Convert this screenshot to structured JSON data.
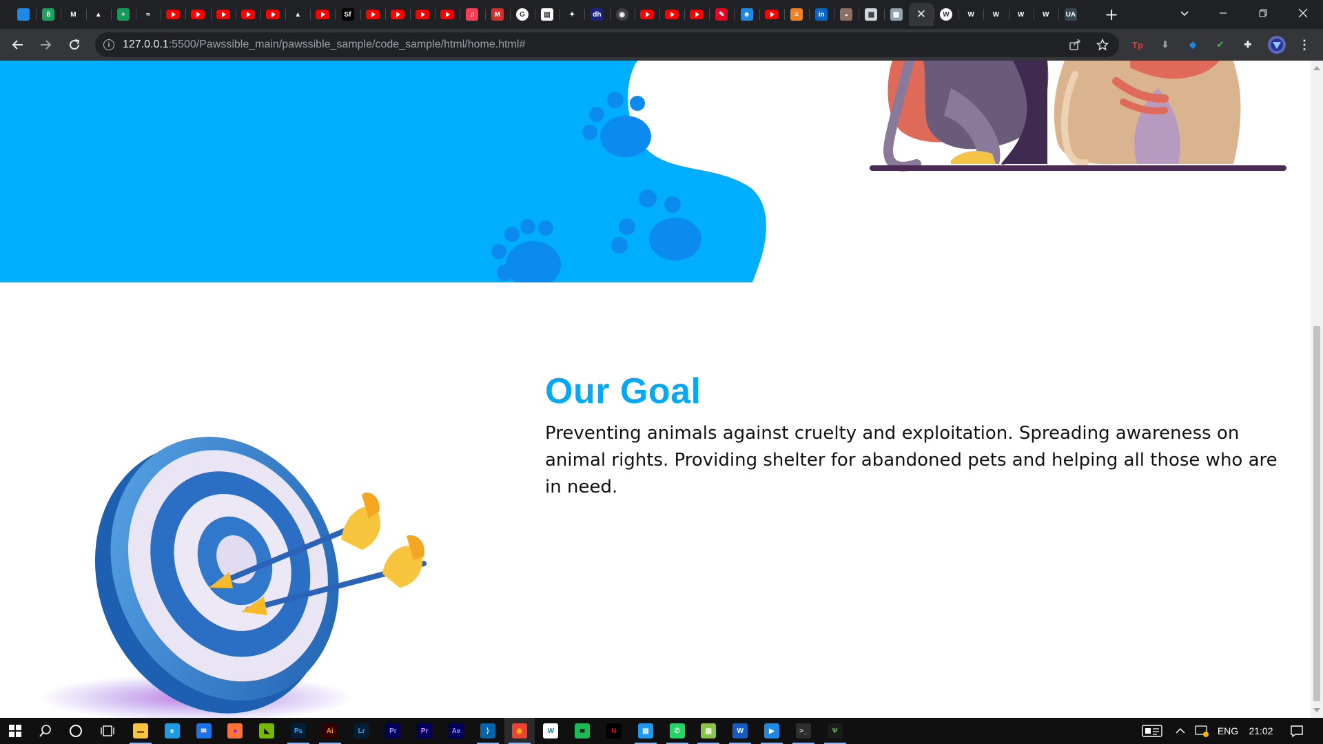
{
  "browser": {
    "tabs": [
      {
        "icon": "sapphire-gem-icon",
        "glyph": "",
        "color": "#1e88e5"
      },
      {
        "icon": "green-tag-icon",
        "glyph": "ß",
        "color": "#1aa260"
      },
      {
        "icon": "gmail-icon",
        "glyph": "M",
        "color": "#202124"
      },
      {
        "icon": "google-drive-icon",
        "glyph": "▲",
        "color": "#202124"
      },
      {
        "icon": "google-sheets-plus-icon",
        "glyph": "+",
        "color": "#0f9d58"
      },
      {
        "icon": "chart-app-icon",
        "glyph": "≈",
        "color": "#202124"
      },
      {
        "icon": "youtube-icon",
        "glyph": "",
        "color": "#ff0000"
      },
      {
        "icon": "youtube-icon",
        "glyph": "",
        "color": "#ff0000"
      },
      {
        "icon": "youtube-icon",
        "glyph": "",
        "color": "#ff0000"
      },
      {
        "icon": "youtube-icon",
        "glyph": "",
        "color": "#ff0000"
      },
      {
        "icon": "youtube-icon",
        "glyph": "",
        "color": "#ff0000"
      },
      {
        "icon": "google-drive-icon",
        "glyph": "▲",
        "color": "#202124"
      },
      {
        "icon": "youtube-icon",
        "glyph": "",
        "color": "#ff0000"
      },
      {
        "icon": "sf-icon",
        "glyph": "Sf",
        "color": "#000000"
      },
      {
        "icon": "youtube-icon",
        "glyph": "",
        "color": "#ff0000"
      },
      {
        "icon": "youtube-icon",
        "glyph": "",
        "color": "#ff0000"
      },
      {
        "icon": "youtube-icon",
        "glyph": "",
        "color": "#ff0000"
      },
      {
        "icon": "youtube-icon",
        "glyph": "",
        "color": "#ff0000"
      },
      {
        "icon": "music-note-icon",
        "glyph": "♫",
        "color": "#fa3c55"
      },
      {
        "icon": "red-m-icon",
        "glyph": "M",
        "color": "#d32f2f"
      },
      {
        "icon": "google-icon",
        "glyph": "G",
        "color": "#ffffff"
      },
      {
        "icon": "document-icon",
        "glyph": "▤",
        "color": "#ffffff"
      },
      {
        "icon": "feather-icon",
        "glyph": "✦",
        "color": "#202124"
      },
      {
        "icon": "dh-icon",
        "glyph": "dh",
        "color": "#1a237e"
      },
      {
        "icon": "globe-icon",
        "glyph": "◉",
        "color": "#424242"
      },
      {
        "icon": "youtube-icon",
        "glyph": "",
        "color": "#ff0000"
      },
      {
        "icon": "youtube-icon",
        "glyph": "",
        "color": "#ff0000"
      },
      {
        "icon": "youtube-icon",
        "glyph": "",
        "color": "#ff0000"
      },
      {
        "icon": "pinterest-like-icon",
        "glyph": "✎",
        "color": "#e60023"
      },
      {
        "icon": "reddit-like-icon",
        "glyph": "☻",
        "color": "#1e88e5"
      },
      {
        "icon": "youtube-icon",
        "glyph": "",
        "color": "#ff0000"
      },
      {
        "icon": "stack-overflow-icon",
        "glyph": "≡",
        "color": "#f48024"
      },
      {
        "icon": "linkedin-icon",
        "glyph": "in",
        "color": "#0a66c2"
      },
      {
        "icon": "food-icon",
        "glyph": "◒",
        "color": "#8d6e63"
      },
      {
        "icon": "image-thumb-icon",
        "glyph": "▦",
        "color": "#cfd8dc"
      },
      {
        "icon": "image-thumb-icon",
        "glyph": "▦",
        "color": "#90a4ae"
      },
      {
        "icon": "close-icon",
        "glyph": "✕",
        "color": "",
        "active": true
      },
      {
        "icon": "wordpress-icon",
        "glyph": "W",
        "color": "#ffffff"
      },
      {
        "icon": "w-green-icon",
        "glyph": "W",
        "color": "#202124"
      },
      {
        "icon": "w-green-icon",
        "glyph": "W",
        "color": "#202124"
      },
      {
        "icon": "w-green-icon",
        "glyph": "W",
        "color": "#202124"
      },
      {
        "icon": "w-green-icon",
        "glyph": "W",
        "color": "#202124"
      },
      {
        "icon": "ua-icon",
        "glyph": "UA",
        "color": "#37474f"
      }
    ],
    "new_tab_label": "+",
    "address": {
      "host": "127.0.0.1",
      "path": ":5500/Pawssible_main/pawssible_sample/code_sample/html/home.html#"
    },
    "toolbar_extensions": [
      {
        "icon": "tp-extension-icon",
        "glyph": "Tp",
        "color": "#e53935"
      },
      {
        "icon": "download-extension-icon",
        "glyph": "⬇",
        "color": "#9e9e9e"
      },
      {
        "icon": "gem-extension-icon",
        "glyph": "◆",
        "color": "#1e88e5"
      },
      {
        "icon": "shield-extension-icon",
        "glyph": "✔",
        "color": "#43a047"
      },
      {
        "icon": "puzzle-extensions-icon",
        "glyph": "✚",
        "color": "#e8eaed"
      }
    ]
  },
  "page": {
    "goal_title": "Our Goal",
    "goal_text": "Preventing animals against cruelty and exploitation. Spreading awareness on animal rights. Providing shelter for abandoned pets and helping all those who are in need.",
    "colors": {
      "accent": "#05a8f5",
      "hero_blue": "#00aeff",
      "paw_blue": "#0b8af0",
      "text": "#111111"
    }
  },
  "taskbar": {
    "apps": [
      {
        "icon": "file-explorer-icon",
        "glyph": "▬",
        "bg": "#f6c642",
        "fg": "#8a5a00",
        "running": true
      },
      {
        "icon": "edge-icon",
        "glyph": "e",
        "bg": "#1f9be0",
        "fg": "#fff"
      },
      {
        "icon": "mail-icon",
        "glyph": "✉",
        "bg": "#1a73e8",
        "fg": "#fff"
      },
      {
        "icon": "firefox-icon",
        "glyph": "●",
        "bg": "#ff7139",
        "fg": "#7b2cbf"
      },
      {
        "icon": "nvidia-icon",
        "glyph": "◣",
        "bg": "#76b900",
        "fg": "#111"
      },
      {
        "icon": "photoshop-icon",
        "glyph": "Ps",
        "bg": "#001e36",
        "fg": "#31a8ff",
        "running": true
      },
      {
        "icon": "illustrator-icon",
        "glyph": "Ai",
        "bg": "#330000",
        "fg": "#ff9a00",
        "running": true
      },
      {
        "icon": "lightroom-icon",
        "glyph": "Lr",
        "bg": "#001e36",
        "fg": "#31a8ff"
      },
      {
        "icon": "premiere-icon",
        "glyph": "Pr",
        "bg": "#00005b",
        "fg": "#9999ff"
      },
      {
        "icon": "premiere-rush-icon",
        "glyph": "Pr",
        "bg": "#00005b",
        "fg": "#d291ff"
      },
      {
        "icon": "after-effects-icon",
        "glyph": "Ae",
        "bg": "#00005b",
        "fg": "#9999ff"
      },
      {
        "icon": "vscode-icon",
        "glyph": "⟩",
        "bg": "#0065a9",
        "fg": "#fff",
        "running": true
      },
      {
        "icon": "chrome-icon",
        "glyph": "◉",
        "bg": "#ea4335",
        "fg": "#fbbc05",
        "running": true,
        "active": true
      },
      {
        "icon": "wordpress-app-icon",
        "glyph": "W",
        "bg": "#ffffff",
        "fg": "#21759b"
      },
      {
        "icon": "spotify-icon",
        "glyph": "≋",
        "bg": "#1db954",
        "fg": "#000"
      },
      {
        "icon": "netflix-icon",
        "glyph": "N",
        "bg": "#000000",
        "fg": "#e50914"
      },
      {
        "icon": "calculator-icon",
        "glyph": "▤",
        "bg": "#2196f3",
        "fg": "#fff",
        "running": true
      },
      {
        "icon": "whatsapp-icon",
        "glyph": "✆",
        "bg": "#25d366",
        "fg": "#fff",
        "running": true
      },
      {
        "icon": "notepad-icon",
        "glyph": "▧",
        "bg": "#8bc34a",
        "fg": "#fff",
        "running": true
      },
      {
        "icon": "word-icon",
        "glyph": "W",
        "bg": "#185abd",
        "fg": "#fff",
        "running": true
      },
      {
        "icon": "media-player-icon",
        "glyph": "▶",
        "bg": "#1e88e5",
        "fg": "#fff",
        "running": true
      },
      {
        "icon": "terminal-icon",
        "glyph": ">_",
        "bg": "#2d2d2d",
        "fg": "#ddd",
        "running": true
      },
      {
        "icon": "razer-icon",
        "glyph": "Ѱ",
        "bg": "#1b1b1b",
        "fg": "#44d62c",
        "running": true
      }
    ],
    "language": "ENG",
    "time": "21:02"
  }
}
